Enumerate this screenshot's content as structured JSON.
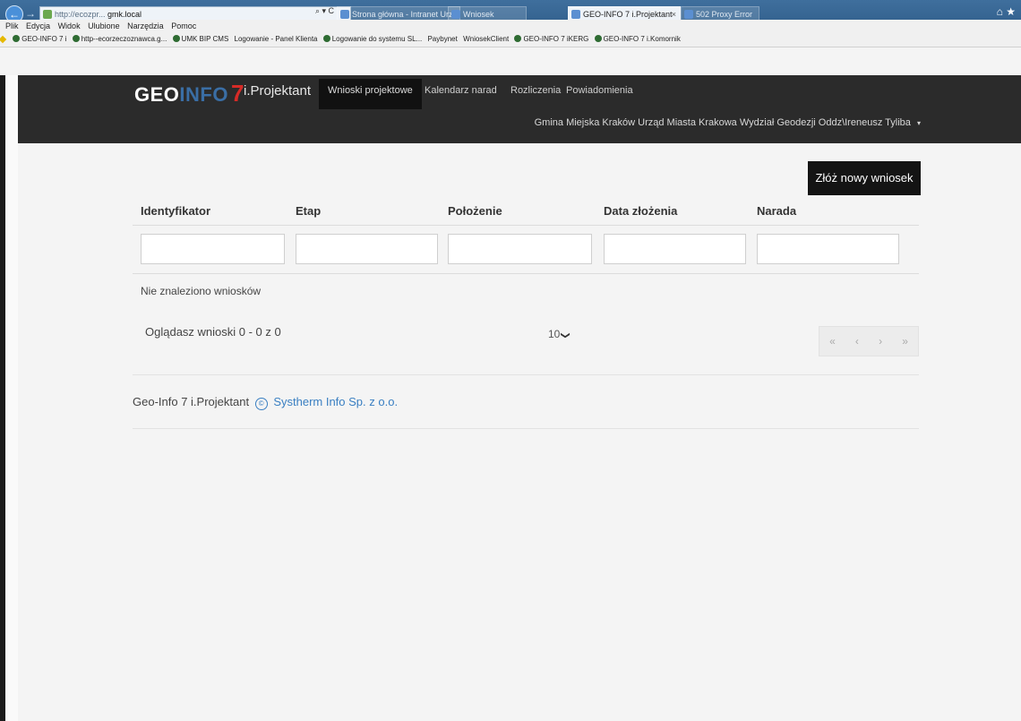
{
  "browser": {
    "address_host": "gmk.local",
    "address_path_prefix": "http://ecozpr...",
    "address_tools": "⌕ ▾ C",
    "tabs": [
      {
        "label": "Strona główna - Intranet Urzęd...",
        "active": false
      },
      {
        "label": "Wniosek",
        "active": false
      },
      {
        "label": "GEO-INFO 7 i.Projektant",
        "active": true
      },
      {
        "label": "502 Proxy Error",
        "active": false
      }
    ],
    "tab_close": "×",
    "menu": [
      "Plik",
      "Edycja",
      "Widok",
      "Ulubione",
      "Narzędzia",
      "Pomoc"
    ],
    "favorites": [
      "GEO-INFO 7 i",
      "http--ecorzeczoznawca.g...",
      "UMK BIP CMS",
      "Logowanie - Panel Klienta",
      "Logowanie do systemu SL...",
      "Paybynet",
      "WniosekClient",
      "GEO-INFO 7 iKERG",
      "GEO-INFO 7 i.Komornik"
    ]
  },
  "header": {
    "logo_geo": "GEO",
    "logo_info": "INFO",
    "logo_seven": "7",
    "app_name": "i.Projektant",
    "nav": [
      {
        "label": "Wnioski projektowe",
        "active": true
      },
      {
        "label": "Kalendarz narad",
        "active": false
      },
      {
        "label": "Rozliczenia",
        "active": false
      },
      {
        "label": "Powiadomienia",
        "active": false
      }
    ],
    "user": "Gmina Miejska Kraków Urząd Miasta Krakowa Wydział Geodezji Oddz\\Ireneusz Tyliba",
    "user_caret": "▾"
  },
  "main": {
    "new_request_label": "Złóż nowy wniosek",
    "columns": [
      "Identyfikator",
      "Etap",
      "Położenie",
      "Data złożenia",
      "Narada"
    ],
    "filters": [
      "",
      "",
      "",
      "",
      ""
    ],
    "empty_message": "Nie znaleziono wniosków",
    "paging_info": "Oglądasz wnioski 0 - 0 z 0",
    "page_size": "10",
    "page_size_chevron": "⌵",
    "pager": {
      "first": "«",
      "prev": "‹",
      "next": "›",
      "last": "»"
    }
  },
  "footer": {
    "product": "Geo-Info 7 i.Projektant",
    "copyright_symbol": "©",
    "company": "Systherm Info Sp. z o.o."
  },
  "colors": {
    "header_bg": "#2b2b2b",
    "logo_info": "#3a6ea5",
    "logo_seven": "#d62b27",
    "link": "#3a7fc2",
    "button_bg": "#141414"
  }
}
